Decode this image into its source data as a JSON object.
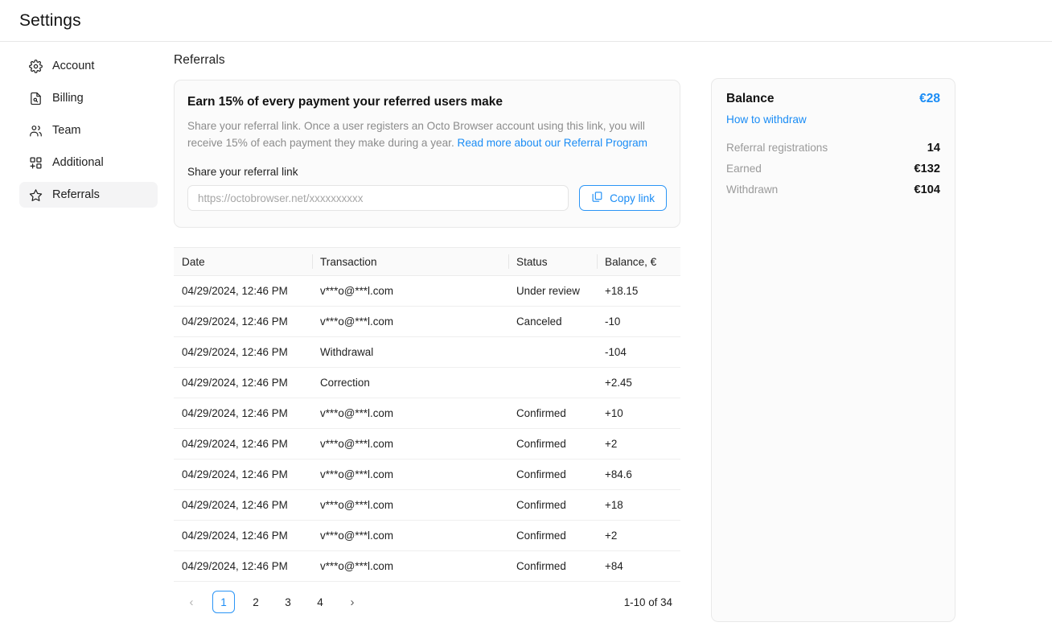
{
  "header": {
    "title": "Settings"
  },
  "sidebar": {
    "items": [
      {
        "label": "Account",
        "icon": "gear-icon",
        "active": false
      },
      {
        "label": "Billing",
        "icon": "invoice-icon",
        "active": false
      },
      {
        "label": "Team",
        "icon": "people-icon",
        "active": false
      },
      {
        "label": "Additional",
        "icon": "grid-plus-icon",
        "active": false
      },
      {
        "label": "Referrals",
        "icon": "star-icon",
        "active": true
      }
    ]
  },
  "main": {
    "section_title": "Referrals",
    "promo": {
      "heading": "Earn 15% of every payment your referred users make",
      "text_part1": "Share your referral link. Once a user registers an Octo Browser account using this link, you will receive 15% of each payment they make during a year. ",
      "link_text": "Read more about our Referral Program",
      "field_label": "Share your referral link",
      "input_value": "",
      "input_placeholder": "https://octobrowser.net/xxxxxxxxxx",
      "copy_label": "Copy link"
    },
    "table": {
      "columns": [
        "Date",
        "Transaction",
        "Status",
        "Balance, €"
      ],
      "rows": [
        {
          "date": "04/29/2024, 12:46 PM",
          "transaction": "v***o@***l.com",
          "status": "Under review",
          "balance": "+18.15"
        },
        {
          "date": "04/29/2024, 12:46 PM",
          "transaction": "v***o@***l.com",
          "status": "Canceled",
          "balance": "-10"
        },
        {
          "date": "04/29/2024, 12:46 PM",
          "transaction": "Withdrawal",
          "status": "",
          "balance": "-104"
        },
        {
          "date": "04/29/2024, 12:46 PM",
          "transaction": "Correction",
          "status": "",
          "balance": "+2.45"
        },
        {
          "date": "04/29/2024, 12:46 PM",
          "transaction": "v***o@***l.com",
          "status": "Confirmed",
          "balance": "+10"
        },
        {
          "date": "04/29/2024, 12:46 PM",
          "transaction": "v***o@***l.com",
          "status": "Confirmed",
          "balance": "+2"
        },
        {
          "date": "04/29/2024, 12:46 PM",
          "transaction": "v***o@***l.com",
          "status": "Confirmed",
          "balance": "+84.6"
        },
        {
          "date": "04/29/2024, 12:46 PM",
          "transaction": "v***o@***l.com",
          "status": "Confirmed",
          "balance": "+18"
        },
        {
          "date": "04/29/2024, 12:46 PM",
          "transaction": "v***o@***l.com",
          "status": "Confirmed",
          "balance": "+2"
        },
        {
          "date": "04/29/2024, 12:46 PM",
          "transaction": "v***o@***l.com",
          "status": "Confirmed",
          "balance": "+84"
        }
      ]
    },
    "pagination": {
      "prev": "‹",
      "pages": [
        "1",
        "2",
        "3",
        "4"
      ],
      "current_page": "1",
      "next": "›",
      "range": "1-10 of 34"
    }
  },
  "balance_card": {
    "title": "Balance",
    "amount": "€28",
    "withdraw_link": "How to withdraw",
    "stats": [
      {
        "label": "Referral registrations",
        "value": "14"
      },
      {
        "label": "Earned",
        "value": "€132"
      },
      {
        "label": "Withdrawn",
        "value": "€104"
      }
    ]
  },
  "colors": {
    "accent_blue": "#1a8cf5",
    "border": "#e9e9e9",
    "card_bg": "#fbfbfb",
    "muted_text": "#8c8c8c",
    "active_nav_bg": "#f4f4f5"
  }
}
